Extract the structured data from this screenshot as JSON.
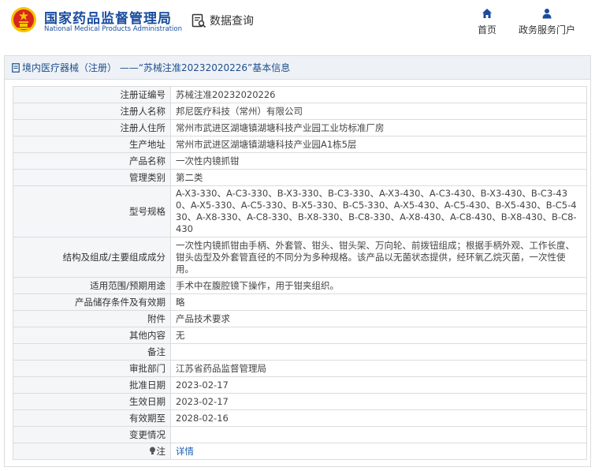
{
  "header": {
    "org_name_cn": "国家药品监督管理局",
    "org_name_en": "National Medical Products Administration",
    "query_label": "数据查询",
    "nav": {
      "home_label": "首页",
      "service_label": "政务服务门户"
    }
  },
  "panel": {
    "title": "境内医疗器械（注册） ——“苏械注准20232020226”基本信息"
  },
  "fields": [
    {
      "key": "注册证编号",
      "value": "苏械注准20232020226"
    },
    {
      "key": "注册人名称",
      "value": "邦尼医疗科技（常州）有限公司"
    },
    {
      "key": "注册人住所",
      "value": "常州市武进区湖塘镇湖塘科技产业园工业坊标准厂房"
    },
    {
      "key": "生产地址",
      "value": "常州市武进区湖塘镇湖塘科技产业园A1栋5层"
    },
    {
      "key": "产品名称",
      "value": "一次性内镜抓钳"
    },
    {
      "key": "管理类别",
      "value": "第二类"
    },
    {
      "key": "型号规格",
      "value": "A-X3-330、A-C3-330、B-X3-330、B-C3-330、A-X3-430、A-C3-430、B-X3-430、B-C3-430、A-X5-330、A-C5-330、B-X5-330、B-C5-330、A-X5-430、A-C5-430、B-X5-430、B-C5-430、A-X8-330、A-C8-330、B-X8-330、B-C8-330、A-X8-430、A-C8-430、B-X8-430、B-C8-430"
    },
    {
      "key": "结构及组成/主要组成成分",
      "value": "一次性内镜抓钳由手柄、外套管、钳头、钳头架、万向轮、前拨钮组成；根据手柄外观、工作长度、钳头齿型及外套管直径的不同分为多种规格。该产品以无菌状态提供，经环氧乙烷灭菌，一次性使用。"
    },
    {
      "key": "适用范围/预期用途",
      "value": "手术中在腹腔镜下操作，用于钳夹组织。"
    },
    {
      "key": "产品储存条件及有效期",
      "value": "略"
    },
    {
      "key": "附件",
      "value": "产品技术要求"
    },
    {
      "key": "其他内容",
      "value": "无"
    },
    {
      "key": "备注",
      "value": ""
    },
    {
      "key": "审批部门",
      "value": "江苏省药品监督管理局"
    },
    {
      "key": "批准日期",
      "value": "2023-02-17"
    },
    {
      "key": "生效日期",
      "value": "2023-02-17"
    },
    {
      "key": "有效期至",
      "value": "2028-02-16"
    },
    {
      "key": "变更情况",
      "value": ""
    }
  ],
  "note": {
    "key": "注",
    "link_label": "详情",
    "icon": "lightbulb-icon"
  },
  "colors": {
    "brand_blue": "#1a4c9e",
    "link_blue": "#1a5fb4",
    "emblem_red": "#d7261e",
    "emblem_gold": "#f5c400"
  }
}
